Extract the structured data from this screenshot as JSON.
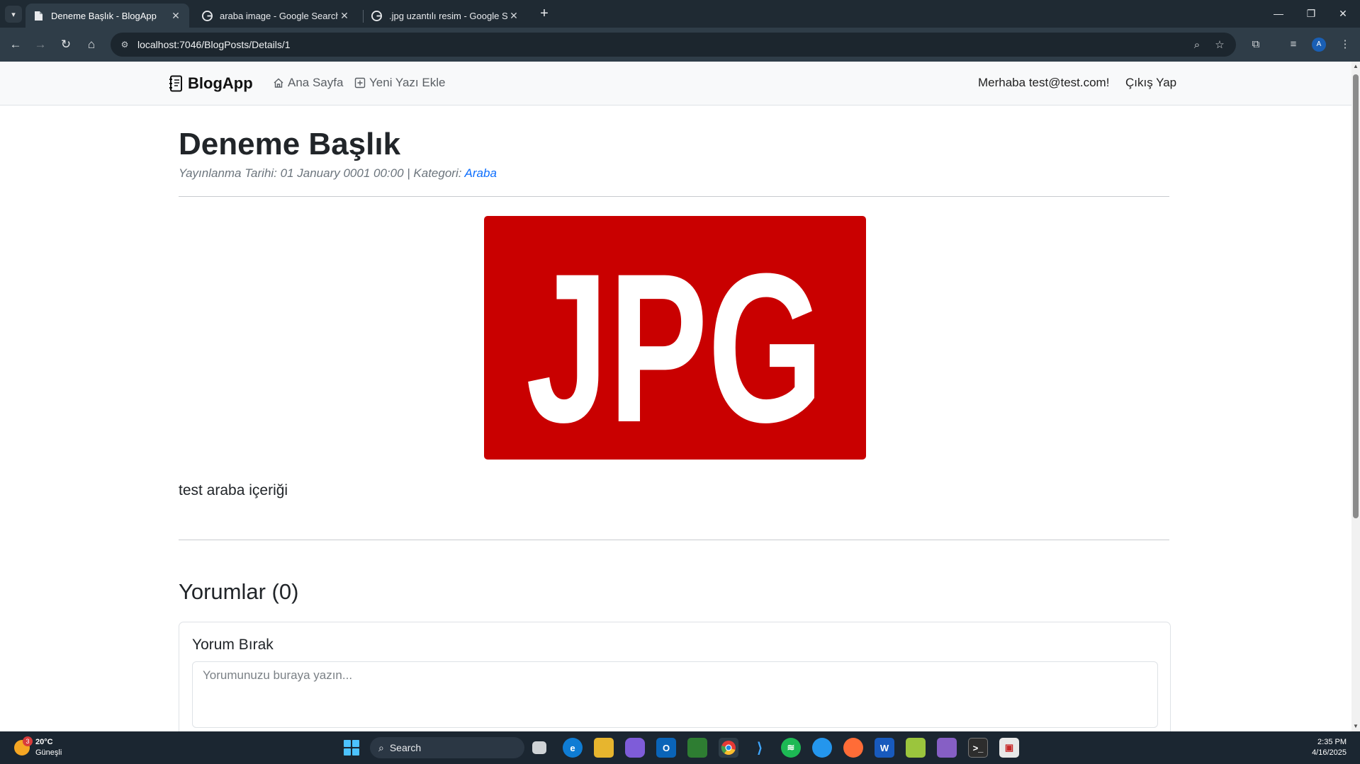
{
  "browser": {
    "tabs": [
      {
        "title": "Deneme Başlık - BlogApp",
        "active": true,
        "favicon": "page-icon"
      },
      {
        "title": "araba image - Google Search",
        "active": false,
        "favicon": "google-icon"
      },
      {
        "title": ".jpg uzantılı resim - Google Search",
        "active": false,
        "favicon": "google-icon"
      }
    ],
    "url": "localhost:7046/BlogPosts/Details/1",
    "profile_initial": "A"
  },
  "navbar": {
    "brand": "BlogApp",
    "links": [
      {
        "label": "Ana Sayfa",
        "icon": "home-icon"
      },
      {
        "label": "Yeni Yazı Ekle",
        "icon": "plus-square-icon"
      }
    ],
    "greeting": "Merhaba test@test.com!",
    "logout": "Çıkış Yap"
  },
  "post": {
    "title": "Deneme Başlık",
    "meta_prefix": "Yayınlanma Tarihi: 01 January 0001 00:00 | Kategori: ",
    "category": "Araba",
    "image_text": "JPG",
    "image_color": "#c90000",
    "content": "test araba içeriği"
  },
  "comments": {
    "heading": "Yorumlar (0)",
    "form_title": "Yorum Bırak",
    "placeholder": "Yorumunuzu buraya yazın..."
  },
  "taskbar": {
    "weather_temp": "20°C",
    "weather_desc": "Güneşli",
    "weather_badge": "3",
    "search_label": "Search",
    "time": "2:35 PM",
    "date": "4/16/2025"
  }
}
